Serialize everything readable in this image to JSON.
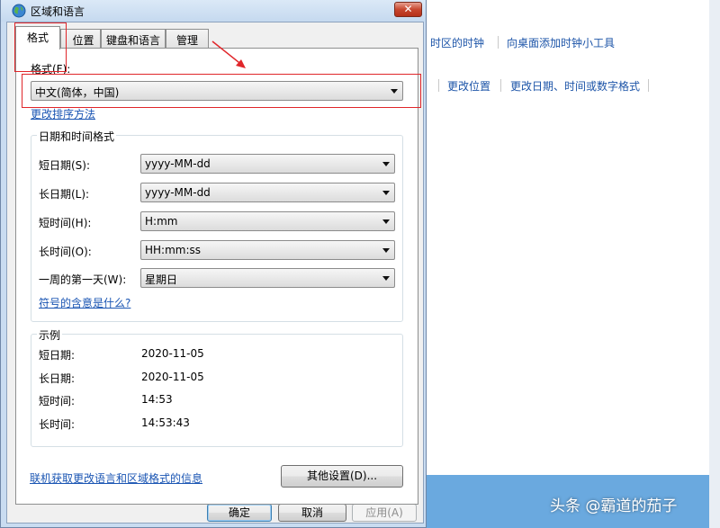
{
  "background_window": {
    "links": [
      "时区的时钟",
      "向桌面添加时钟小工具",
      "更改位置",
      "更改日期、时间或数字格式"
    ]
  },
  "watermark": "头条 @霸道的茄子",
  "dialog": {
    "title": "区域和语言",
    "close_label": "✕",
    "tabs": [
      "格式",
      "位置",
      "键盘和语言",
      "管理"
    ],
    "format_label": "格式(F):",
    "format_value": "中文(简体，中国)",
    "sort_link": "更改排序方法",
    "datetime_group": {
      "title": "日期和时间格式",
      "rows": [
        {
          "label": "短日期(S):",
          "value": "yyyy-MM-dd"
        },
        {
          "label": "长日期(L):",
          "value": "yyyy-MM-dd"
        },
        {
          "label": "短时间(H):",
          "value": "H:mm"
        },
        {
          "label": "长时间(O):",
          "value": "HH:mm:ss"
        },
        {
          "label": "一周的第一天(W):",
          "value": "星期日"
        }
      ],
      "symbols_link": "符号的含意是什么?"
    },
    "example_group": {
      "title": "示例",
      "rows": [
        {
          "label": "短日期:",
          "value": "2020-11-05"
        },
        {
          "label": "长日期:",
          "value": "2020-11-05"
        },
        {
          "label": "短时间:",
          "value": "14:53"
        },
        {
          "label": "长时间:",
          "value": "14:53:43"
        }
      ]
    },
    "other_settings_button": "其他设置(D)...",
    "online_link": "联机获取更改语言和区域格式的信息",
    "ok_button": "确定",
    "cancel_button": "取消",
    "apply_button": "应用(A)"
  },
  "colors": {
    "highlight": "#e0262a",
    "link": "#1a55b3",
    "desktop": "#2b7cc9"
  }
}
